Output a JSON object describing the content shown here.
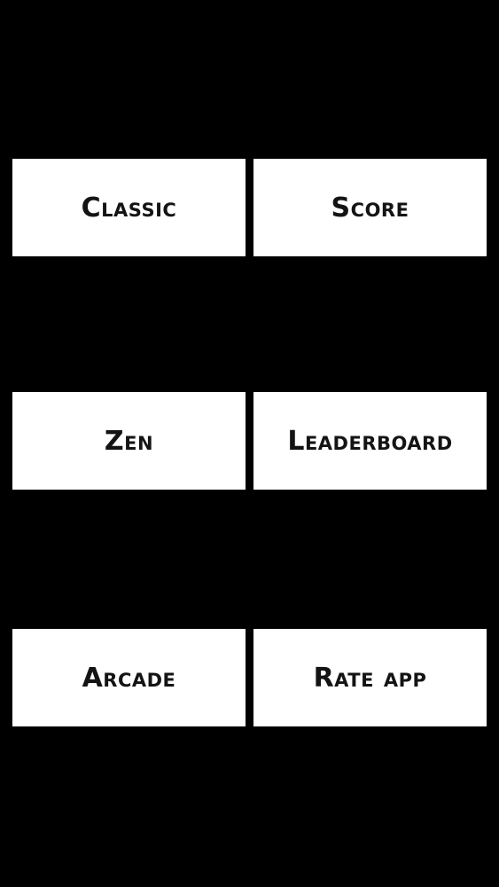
{
  "colors": {
    "background": "#000000",
    "tile": "#ffffff",
    "text": "#141414"
  },
  "menu": {
    "classic": "Classic",
    "score": "Score",
    "zen": "Zen",
    "leaderboard": "Leaderboard",
    "arcade": "Arcade",
    "rate_app": "Rate app"
  }
}
